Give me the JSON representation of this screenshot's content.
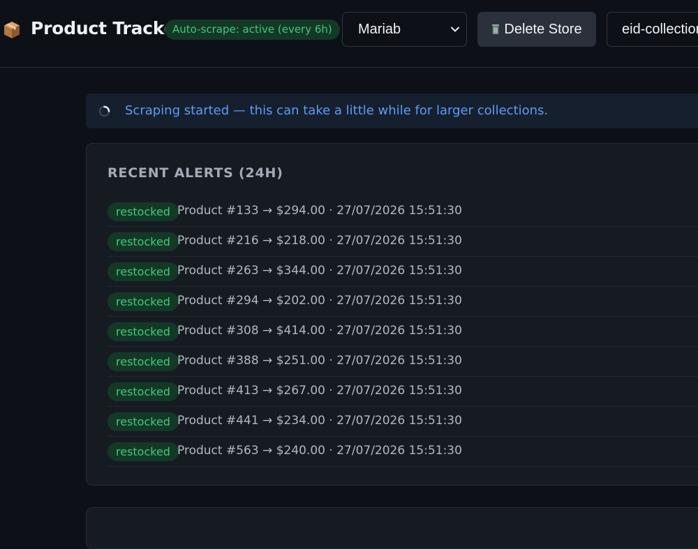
{
  "header": {
    "title": "Product Tracker",
    "brand_icon": "package-icon",
    "auto_scrape_badge": "Auto-scrape: active (every 6h)",
    "store_select": {
      "value": "Mariab"
    },
    "delete_button": {
      "icon": "trash-icon",
      "label": "Delete Store"
    },
    "collection_input": {
      "value": "eid-collection"
    }
  },
  "info_banner": {
    "text": "Scraping started — this can take a little while for larger collections."
  },
  "alerts": {
    "title": "RECENT ALERTS (24H)",
    "items": [
      {
        "badge": "restocked",
        "text": "Product #133 → $294.00 · 27/07/2026 15:51:30"
      },
      {
        "badge": "restocked",
        "text": "Product #216 → $218.00 · 27/07/2026 15:51:30"
      },
      {
        "badge": "restocked",
        "text": "Product #263 → $344.00 · 27/07/2026 15:51:30"
      },
      {
        "badge": "restocked",
        "text": "Product #294 → $202.00 · 27/07/2026 15:51:30"
      },
      {
        "badge": "restocked",
        "text": "Product #308 → $414.00 · 27/07/2026 15:51:30"
      },
      {
        "badge": "restocked",
        "text": "Product #388 → $251.00 · 27/07/2026 15:51:30"
      },
      {
        "badge": "restocked",
        "text": "Product #413 → $267.00 · 27/07/2026 15:51:30"
      },
      {
        "badge": "restocked",
        "text": "Product #441 → $234.00 · 27/07/2026 15:51:30"
      },
      {
        "badge": "restocked",
        "text": "Product #563 → $240.00 · 27/07/2026 15:51:30"
      }
    ]
  },
  "colors": {
    "background": "#0d1117",
    "card": "#161b22",
    "accent_green": "#3fca7a",
    "info_blue": "#5e9cf5"
  }
}
